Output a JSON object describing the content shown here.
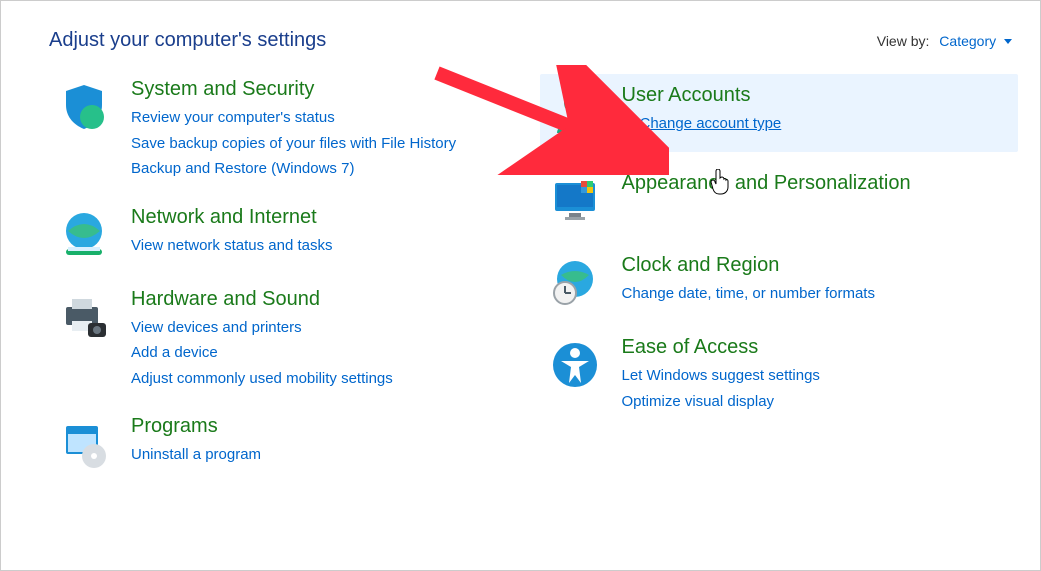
{
  "header": {
    "title": "Adjust your computer's settings",
    "viewby_label": "View by:",
    "viewby_value": "Category"
  },
  "left": [
    {
      "title": "System and Security",
      "links": [
        {
          "label": "Review your computer's status",
          "shield": false
        },
        {
          "label": "Save backup copies of your files with File History",
          "shield": false
        },
        {
          "label": "Backup and Restore (Windows 7)",
          "shield": false
        }
      ]
    },
    {
      "title": "Network and Internet",
      "links": [
        {
          "label": "View network status and tasks",
          "shield": false
        }
      ]
    },
    {
      "title": "Hardware and Sound",
      "links": [
        {
          "label": "View devices and printers",
          "shield": false
        },
        {
          "label": "Add a device",
          "shield": false
        },
        {
          "label": "Adjust commonly used mobility settings",
          "shield": false
        }
      ]
    },
    {
      "title": "Programs",
      "links": [
        {
          "label": "Uninstall a program",
          "shield": false
        }
      ]
    }
  ],
  "right": [
    {
      "title": "User Accounts",
      "highlight": true,
      "links": [
        {
          "label": "Change account type",
          "shield": true,
          "hovered": true
        }
      ]
    },
    {
      "title": "Appearance and Personalization",
      "links": []
    },
    {
      "title": "Clock and Region",
      "links": [
        {
          "label": "Change date, time, or number formats",
          "shield": false
        }
      ]
    },
    {
      "title": "Ease of Access",
      "links": [
        {
          "label": "Let Windows suggest settings",
          "shield": false
        },
        {
          "label": "Optimize visual display",
          "shield": false
        }
      ]
    }
  ]
}
